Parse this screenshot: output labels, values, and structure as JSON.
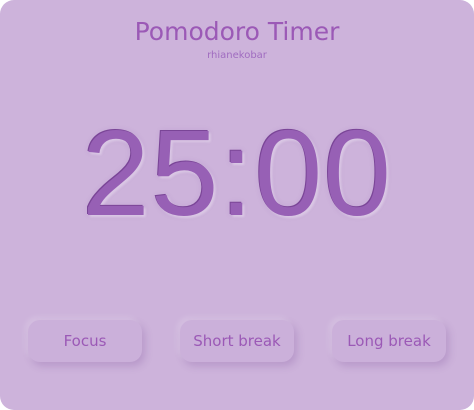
{
  "app": {
    "title": "Pomodoro Timer",
    "author": "rhianekobar"
  },
  "timer": {
    "display": "25:00"
  },
  "modes": [
    {
      "label": "Focus"
    },
    {
      "label": "Short break"
    },
    {
      "label": "Long break"
    }
  ],
  "colors": {
    "background": "#cdb3db",
    "accent": "#9b59b6"
  }
}
